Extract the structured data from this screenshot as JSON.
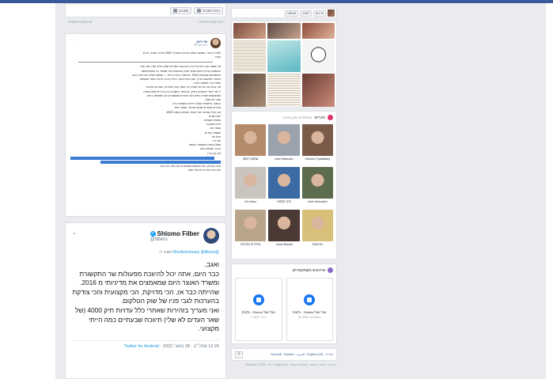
{
  "feed": {
    "toolbar": {
      "manage_label": "ניהול פוסטים",
      "filter_label": "מסננים"
    },
    "meta_left": "לא מוצגים פוסטים",
    "meta_right": "הצג תצוגת רשימה"
  },
  "post": {
    "author": "שי ניצן",
    "date": "25 באוגוסט",
    "lines": [
      "לאחר גן ארי, שמעתי שלנו עליכם בתאריך 4000 לאחר הקרה, או לך",
      "מכם",
      "",
      "אני נושא כאן, היום זה היה היום שבו הסתיים שלנו עלינו של היום, שבו",
      "המשפט והתיק ההוא שלא ישכח והמאבק הזה שעמד כה שהתפרסמו",
      "באשמתם שבאמת 4000, יש שלה בהם הריכוז — שלשה שלה הוא חבל בהם",
      "מאחר ולמעשה ש לו, הוא דוחה אותו, והכל הרבה הרבה מאוד שאפשר",
      "עצמי כבר לעשות כלום.",
      "אני כותב את זה כמי שהיה עד ועמד מול הצדדים, ועם מה שראה",
      "כי אני אחד הנוגעים בתיק, ובמיוחד נחשבים בו בדברים שלא נאמרו",
      "ושהמשפט שאינו בתיק הזה והעדים שנשארים על המשפט בתיק",
      "שוב: לא שלנו",
      "",
      "המצב: החשיפה שלנו הייתה ונמשכת ככה",
      "אחרים אומרים שהוא מפחד, ואומר זאת",
      "מה רגיל באמת, אולי אומר העולם באמת 4000",
      "כמה שנים",
      "שאלתי שאלות",
      "פנים חשיבה",
      "שומר מה",
      "משפט העדים",
      "איש פה",
      "ועל נייר",
      "שאלו אותנו במשפט הנושא",
      "הדבר שמלא אותו",
      "לא יום הדין"
    ],
    "footer_lines": [
      "מים כפולים, ועל האנשים שאומרים לא ספר על היום",
      "ולא היום ולא הרים של כולם."
    ]
  },
  "tweet": {
    "name": "Shlomo Filber",
    "handle": "@filbers",
    "reply_prefix": "משיב ל-",
    "reply_handles": "@BiroAshcknasy @filbers",
    "text": "ואגב,\nכבר היום, אתה יכול להיווכח מפעולות שר התקשורת ומשרד האוצר היום שמאמצים את מדיניותי מ 2016.\nשהייתה כבר אז, הכי מדויקת, הכי מקצועית והכי צודקת בהערכות לגבי פניו של שוק הטלקום.\nואני מעריך בזהירות שאחרי כלל עדויות תיק 4000 (של שאר העדים לא שלי) תיווכח שבעתיים כמה הייתי מקצועי.",
    "time": "12:26 אחה״צ · 28 באוג׳ 2020 ·",
    "client": "Twitter for Android"
  },
  "right": {
    "topbar": {
      "name_select": "שי ניצן",
      "year_select": "2020",
      "month_select": "אוגוסט"
    },
    "friends": {
      "title": "חברים",
      "count": "5,000 (264 משותפים)",
      "items": [
        {
          "name": "Shlomo Pyalstitsky",
          "color": "#7a5a48"
        },
        {
          "name": "Ariel Wismain",
          "color": "#9aa3ad"
        },
        {
          "name": "שמעון וייסמן",
          "color": "#b58c6a"
        },
        {
          "name": "Ariel Schnabel",
          "color": "#5d6b4f"
        },
        {
          "name": "ברוך קסטרו",
          "color": "#3c6aa3"
        },
        {
          "name": "Ziv Maor",
          "color": "#c9c4bd"
        },
        {
          "name": "אבינועם",
          "color": "#d8c07a"
        },
        {
          "name": "Yaniv Bardal",
          "color": "#4a3a33"
        },
        {
          "name": "שירה בן אברהם",
          "color": "#b9a58c"
        }
      ]
    },
    "events": {
      "title": "אירועים משמעותיים",
      "items": [
        {
          "title": "עבד אצל Globes - גלובס",
          "date": "26 בספטמבר 2016"
        },
        {
          "title": "עבד אצל Globes - גלובס",
          "date": "1 ביוני 2017"
        }
      ]
    },
    "languages": "עברית · English (US) · العربية · Pусский · Español",
    "footer": "פרטיות · תנאים · פרסום · אפשרויות פרסום · קובצי Cookie · עוד · Facebook © 2020"
  }
}
